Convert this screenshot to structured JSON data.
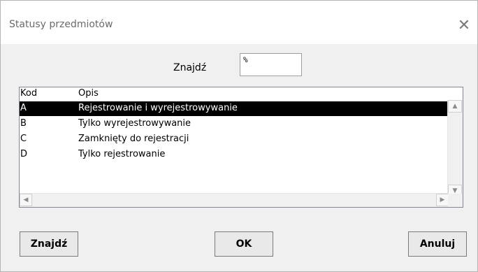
{
  "window": {
    "title": "Statusy przedmiotów",
    "close_icon": "close-icon"
  },
  "search": {
    "label": "Znajdź",
    "value": "%"
  },
  "list": {
    "columns": [
      "Kod",
      "Opis"
    ],
    "rows": [
      {
        "code": "A",
        "desc": "Rejestrowanie i wyrejestrowywanie",
        "selected": true
      },
      {
        "code": "B",
        "desc": "Tylko wyrejestrowywanie",
        "selected": false
      },
      {
        "code": "C",
        "desc": "Zamknięty do rejestracji",
        "selected": false
      },
      {
        "code": "D",
        "desc": "Tylko rejestrowanie",
        "selected": false
      }
    ]
  },
  "buttons": {
    "find": "Znajdź",
    "ok": "OK",
    "cancel": "Anuluj"
  }
}
